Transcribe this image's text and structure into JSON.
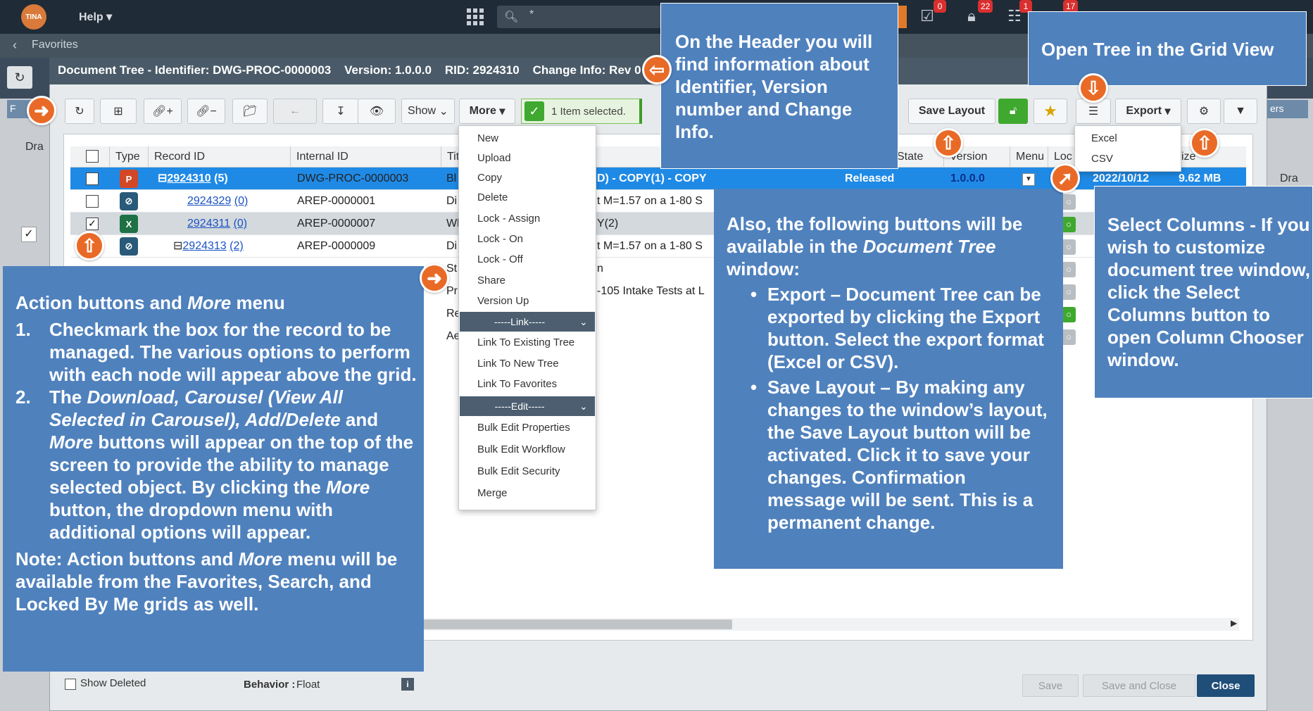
{
  "topbar": {
    "logo": "TINA",
    "help": "Help",
    "search_value": "*",
    "badges": [
      "0",
      "22",
      "1",
      "17"
    ]
  },
  "favbar": {
    "label": "Favorites"
  },
  "background": {
    "left_tab": "F",
    "drag": "Dra",
    "right_tab": "ers",
    "right_drag": "Dra"
  },
  "dialog": {
    "title": "Document Tree - Identifier: DWG-PROC-0000003    Version: 1.0.0.0    RID: 2924310    Change Info: Rev 0"
  },
  "toolbar": {
    "show_label": "Show",
    "more_label": "More",
    "selected_text": "1 Item selected.",
    "save_layout": "Save Layout",
    "export_label": "Export"
  },
  "grid": {
    "columns": [
      "Type",
      "Record ID",
      "Internal ID",
      "Tit",
      "State",
      "Version",
      "Menu",
      "Loc",
      "ize"
    ],
    "rows": [
      {
        "record": "2924310",
        "count": "(5)",
        "internal": "DWG-PROC-0000003",
        "title_start": "Bl",
        "title_end": "D) - COPY(1) - COPY",
        "state": "Released",
        "version": "1.0.0.0",
        "date": "2022/10/12",
        "size": "9.62 MB"
      },
      {
        "record": "2924329",
        "count": "(0)",
        "internal": "AREP-0000001",
        "title_start": "Di",
        "title_end": "t M=1.57 on a 1-80 S"
      },
      {
        "record": "2924311",
        "count": "(0)",
        "internal": "AREP-0000007",
        "title_start": "Wl",
        "title_end": "Y(2)"
      },
      {
        "record": "2924313",
        "count": "(2)",
        "internal": "AREP-0000009",
        "title_start": "Di",
        "title_end": "t M=1.57 on a 1-80 S"
      },
      {
        "title_start": "St",
        "title_end": "n"
      },
      {
        "title_start": "Pr",
        "title_end": "-105 Intake Tests at L"
      },
      {
        "title_start": "Re"
      },
      {
        "title_start": "Ae"
      }
    ]
  },
  "more_menu": {
    "items_top": [
      "New",
      "Upload",
      "Copy",
      "Delete",
      "Lock - Assign",
      "Lock - On",
      "Lock - Off",
      "Share",
      "Version Up"
    ],
    "link_sep": "-----Link-----",
    "items_link": [
      "Link To Existing Tree",
      "Link To New Tree",
      "Link To Favorites"
    ],
    "edit_sep": "-----Edit-----",
    "items_edit": [
      "Bulk Edit Properties",
      "Bulk Edit Workflow",
      "Bulk Edit Security",
      "Merge"
    ]
  },
  "export_menu": {
    "items": [
      "Excel",
      "CSV"
    ]
  },
  "footer": {
    "show_deleted": "Show Deleted",
    "behavior_label": "Behavior :",
    "behavior_value": "Float",
    "save": "Save",
    "save_close": "Save and Close",
    "close": "Close"
  },
  "callouts": {
    "header": "On the Header you will find information about Identifier, Version number and Change Info.",
    "tree": "Open Tree in the Grid View",
    "select_columns": "Select Columns - If you wish to customize document tree window, click the Select Columns button to open Column Chooser window.",
    "doc_tree_intro_a": "Also, the following buttons will be available in the ",
    "doc_tree_intro_em": "Document Tree",
    "doc_tree_intro_b": " window:",
    "export_bullet": "Export – Document Tree can be exported by clicking the Export button. Select the export format (Excel or CSV).",
    "save_layout_bullet": "Save Layout – By making any changes to the window’s layout, the Save Layout button will be activated. Click it to save your changes. Confirmation message will be sent. This is a permanent change.",
    "action_title_a": "Action buttons and ",
    "action_title_em": "More",
    "action_title_b": " menu",
    "step1_num": "1.",
    "step1": "Checkmark the box for the record to be managed. The various options to perform with each node will appear above the grid.",
    "step2_num": "2.",
    "step2_a": "The ",
    "step2_em1": "Download, Carousel (View All Selected in Carousel), Add/Delete",
    "step2_b": " and ",
    "step2_em2": "More",
    "step2_c": " buttons will appear on the top of the screen to provide the ability to manage selected object. By clicking the ",
    "step2_em3": "More",
    "step2_d": " button, the dropdown menu with additional options will appear.",
    "note_a": "Note: Action buttons and ",
    "note_em": "More",
    "note_b": " menu will be available from the Favorites, Search, and Locked By Me grids as well."
  },
  "colors": {
    "callout": "#4f81bd",
    "arrow": "#e96a26",
    "selected_row": "#1f8ae6",
    "green": "#3fa82f"
  }
}
